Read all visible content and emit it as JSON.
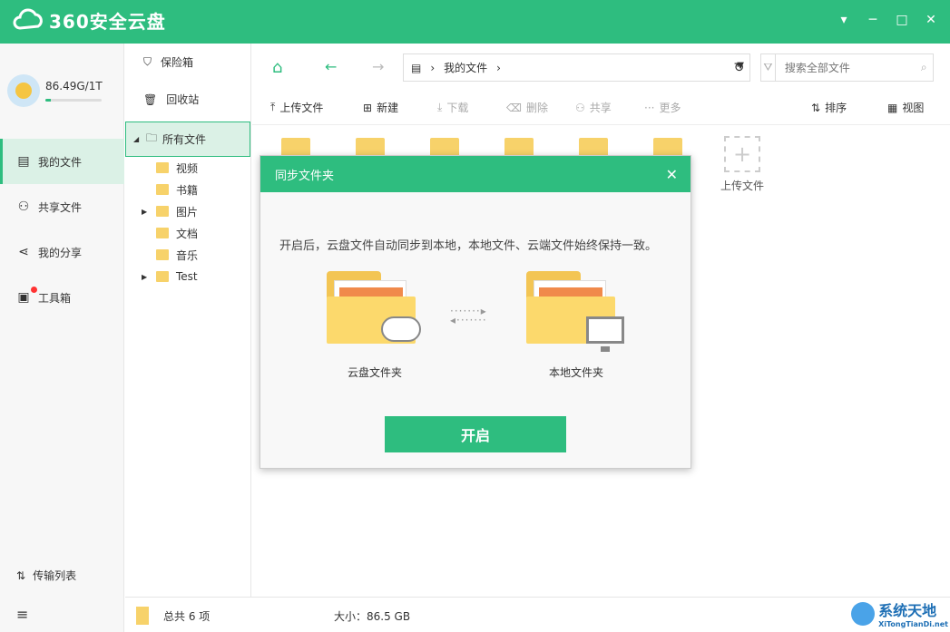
{
  "app": {
    "title": "360安全云盘",
    "window_buttons": [
      "▾",
      "─",
      "□",
      "✕"
    ]
  },
  "user": {
    "quota": "86.49G/1T",
    "quota_fraction": 0.09
  },
  "sidebar": {
    "items": [
      {
        "label": "我的文件",
        "icon": "file-icon",
        "active": true
      },
      {
        "label": "共享文件",
        "icon": "users-icon"
      },
      {
        "label": "我的分享",
        "icon": "share-icon"
      },
      {
        "label": "工具箱",
        "icon": "toolbox-icon",
        "badge": true
      }
    ],
    "transfer": "传输列表"
  },
  "tree": {
    "safe": "保险箱",
    "recycle": "回收站",
    "all_files": "所有文件",
    "folders": [
      "视频",
      "书籍",
      "图片",
      "文档",
      "音乐",
      "Test"
    ]
  },
  "navbar": {
    "path": "我的文件",
    "search_placeholder": "搜索全部文件"
  },
  "toolbar": {
    "upload": "上传文件",
    "new": "新建",
    "download": "下载",
    "delete": "删除",
    "share": "共享",
    "more": "更多",
    "sort": "排序",
    "view": "视图"
  },
  "grid": {
    "upload_label": "上传文件"
  },
  "status": {
    "count": "总共 6 项",
    "size": "大小：86.5 GB"
  },
  "watermark": {
    "t1": "系统天地",
    "t2": "XiTongTianDi.net"
  },
  "dialog": {
    "title": "同步文件夹",
    "desc": "开启后，云盘文件自动同步到本地，本地文件、云端文件始终保持一致。",
    "cloud_label": "云盘文件夹",
    "local_label": "本地文件夹",
    "button": "开启"
  },
  "colors": {
    "accent": "#2ebd7f",
    "folder": "#f7d26a"
  }
}
